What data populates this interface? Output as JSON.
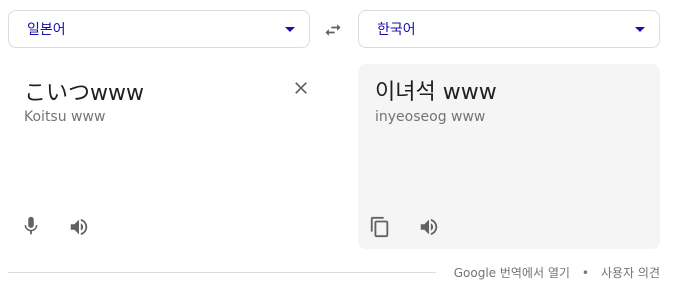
{
  "languages": {
    "source": "일본어",
    "target": "한국어"
  },
  "source_panel": {
    "text": "こいつwww",
    "romanization": "Koitsu www"
  },
  "target_panel": {
    "text": "이녀석 www",
    "romanization": "inyeoseog www"
  },
  "footer": {
    "open_link": "Google 번역에서 열기",
    "separator": "•",
    "feedback_link": "사용자 의견"
  },
  "icons": {
    "caret": "chevron-down-icon",
    "swap": "swap-arrows-icon",
    "clear": "close-icon",
    "mic": "microphone-icon",
    "speaker": "speaker-icon",
    "copy": "copy-icon"
  },
  "colors": {
    "accent": "#1a0dab",
    "border": "#dadce0",
    "icon": "#5f6368",
    "target_bg": "#f5f5f5",
    "secondary_text": "#70757a",
    "main_text": "#202124"
  }
}
